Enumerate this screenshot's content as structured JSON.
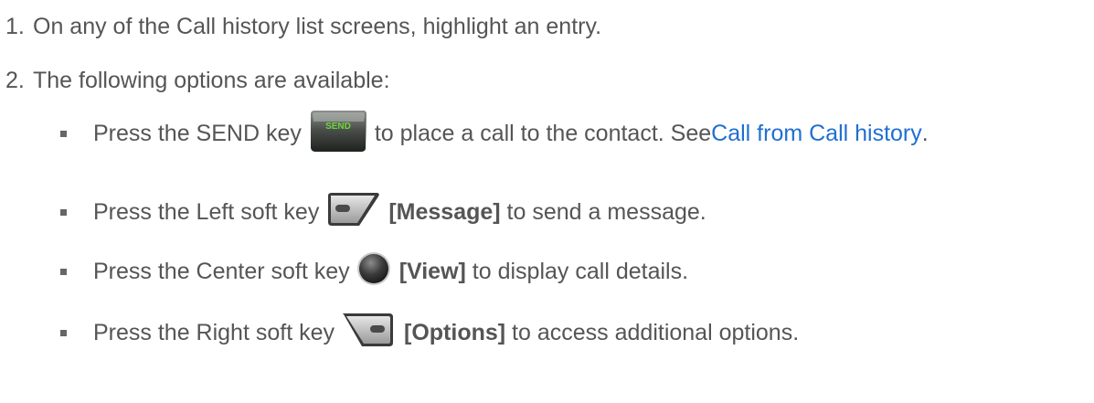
{
  "steps": [
    {
      "num": "1.",
      "text": "On any of the Call history list screens, highlight an entry."
    },
    {
      "num": "2.",
      "text": "The following options are available:"
    }
  ],
  "bullets": [
    {
      "pre": "Press the SEND key",
      "icon": "send-key-icon",
      "icon_text": "SEND",
      "post": "to place a call to the contact. See ",
      "link": "Call from Call history",
      "tail": "."
    },
    {
      "pre": "Press the Left soft key",
      "icon": "left-soft-key-icon",
      "bold": "[Message]",
      "post": " to send a message."
    },
    {
      "pre": "Press the Center soft key",
      "icon": "center-soft-key-icon",
      "bold": "[View]",
      "post": " to display call details."
    },
    {
      "pre": "Press the Right soft key",
      "icon": "right-soft-key-icon",
      "bold": "[Options]",
      "post": " to access additional options."
    }
  ]
}
